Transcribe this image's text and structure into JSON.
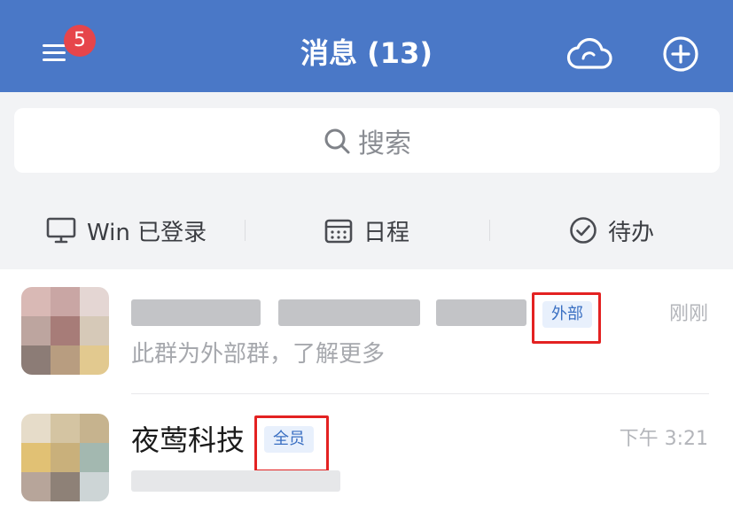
{
  "header": {
    "title": "消息 (13)",
    "menu_badge": "5",
    "accent_color": "#4a78c7",
    "badge_color": "#e6454b",
    "icons": [
      "menu-icon",
      "cloud-icon",
      "plus-circle-icon"
    ]
  },
  "search": {
    "placeholder": "搜索",
    "icon": "search-icon"
  },
  "quick_actions": [
    {
      "label": "Win 已登录",
      "icon": "monitor-icon"
    },
    {
      "label": "日程",
      "icon": "calendar-icon"
    },
    {
      "label": "待办",
      "icon": "check-circle-icon"
    }
  ],
  "conversations": [
    {
      "title_hidden": true,
      "tag": "外部",
      "subtitle": "此群为外部群，了解更多",
      "time": "刚刚"
    },
    {
      "title": "夜莺科技",
      "tag": "全员",
      "subtitle_hidden": true,
      "time": "下午 3:21"
    }
  ],
  "annotation_color": "#e32222"
}
